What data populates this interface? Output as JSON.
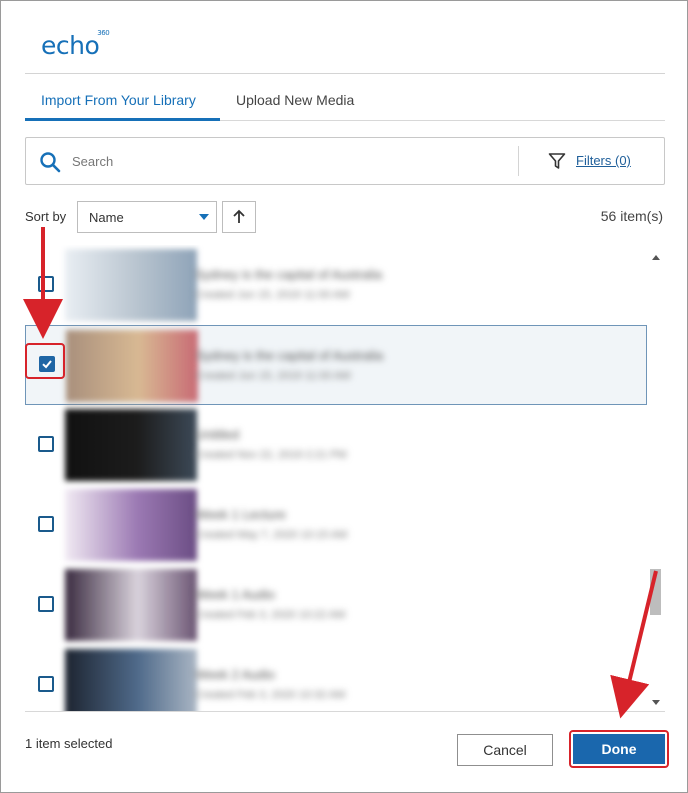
{
  "app": {
    "logo_text": "echo",
    "logo_superscript": "360"
  },
  "tabs": [
    {
      "label": "Import From Your Library",
      "active": true
    },
    {
      "label": "Upload New Media",
      "active": false
    }
  ],
  "search": {
    "placeholder": "Search",
    "value": ""
  },
  "filters": {
    "label": "Filters (0)"
  },
  "sort": {
    "label": "Sort by",
    "selected": "Name",
    "direction": "ascending"
  },
  "list": {
    "count_label": "56 item(s)"
  },
  "media_items": [
    {
      "title": "Sydney is the capital of Australia",
      "date": "Created Jun 15, 2019 11:00 AM",
      "checked": false,
      "thumb_colors": [
        "#e9eef3",
        "#b8c4cf",
        "#8ea3b8"
      ]
    },
    {
      "title": "Sydney is the capital of Australia",
      "date": "Created Jun 15, 2019 11:00 AM",
      "checked": true,
      "thumb_colors": [
        "#a88f7c",
        "#d8b993",
        "#c86a74"
      ]
    },
    {
      "title": "Untitled",
      "date": "Created Nov 22, 2019 2:21 PM",
      "checked": false,
      "thumb_colors": [
        "#111111",
        "#1c1c1c",
        "#3d4a58"
      ]
    },
    {
      "title": "Week 1 Lecture",
      "date": "Created May 7, 2020 10:15 AM",
      "checked": false,
      "thumb_colors": [
        "#f1eaf3",
        "#9b79b3",
        "#6b4d84"
      ]
    },
    {
      "title": "Week 1 Audio",
      "date": "Created Feb 3, 2020 10:22 AM",
      "checked": false,
      "thumb_colors": [
        "#3a2b40",
        "#d9d2dc",
        "#6a5472"
      ]
    },
    {
      "title": "Week 2 Audio",
      "date": "Created Feb 3, 2020 10:32 AM",
      "checked": false,
      "thumb_colors": [
        "#1d2430",
        "#4f6a8a",
        "#aab6c4"
      ]
    }
  ],
  "footer": {
    "selected_label": "1 item selected",
    "cancel_label": "Cancel",
    "done_label": "Done"
  },
  "colors": {
    "brand": "#1670b8",
    "primary_button": "#1a67ad",
    "annotation": "#d7232a"
  }
}
